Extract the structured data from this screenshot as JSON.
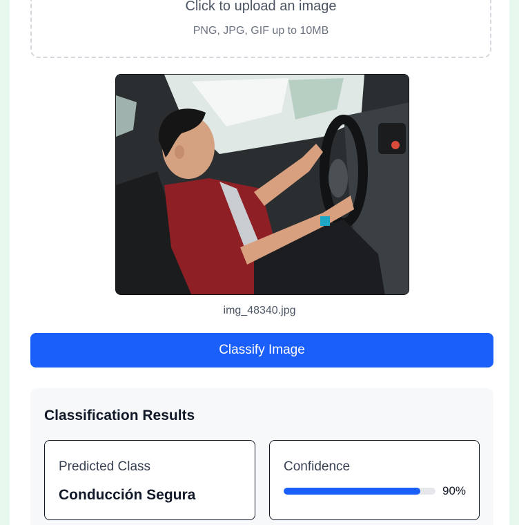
{
  "upload": {
    "title": "Click to upload an image",
    "subtitle": "PNG, JPG, GIF up to 10MB"
  },
  "preview": {
    "filename": "img_48340.jpg"
  },
  "actions": {
    "classify_label": "Classify Image"
  },
  "results": {
    "title": "Classification Results",
    "predicted_label": "Predicted Class",
    "predicted_value": "Conducción Segura",
    "confidence_label": "Confidence",
    "confidence_fraction": 0.9,
    "confidence_text": "90%"
  },
  "colors": {
    "accent": "#1a5ffa",
    "page_bg": "#e7f8ee"
  }
}
